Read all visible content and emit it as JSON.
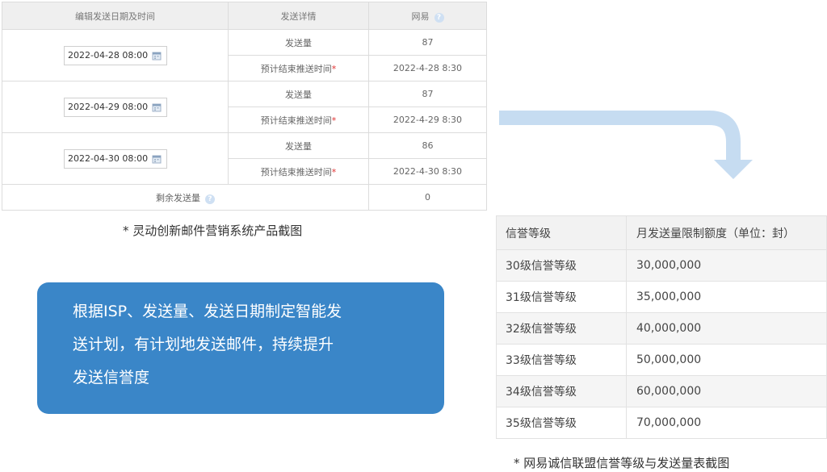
{
  "schedule": {
    "headers": {
      "date": "编辑发送日期及时间",
      "details": "发送详情",
      "isp": "网易"
    },
    "groups": [
      {
        "date": "2022-04-28 08:00",
        "volume_label": "发送量",
        "volume": "87",
        "eta_label": "预计结束推送时间",
        "eta": "2022-4-28 8:30"
      },
      {
        "date": "2022-04-29 08:00",
        "volume_label": "发送量",
        "volume": "87",
        "eta_label": "预计结束推送时间",
        "eta": "2022-4-29 8:30"
      },
      {
        "date": "2022-04-30 08:00",
        "volume_label": "发送量",
        "volume": "86",
        "eta_label": "预计结束推送时间",
        "eta": "2022-4-30 8:30"
      }
    ],
    "remaining_label": "剩余发送量",
    "remaining_value": "0",
    "required_mark": "*",
    "help_mark": "?"
  },
  "caption_left": "* 灵动创新邮件营销系统产品截图",
  "callout": {
    "line1": "根据ISP、发送量、发送日期制定智能发",
    "line2": "送计划，有计划地发送邮件，持续提升",
    "line3": "发送信誉度"
  },
  "reputation": {
    "headers": {
      "level": "信誉等级",
      "limit": "月发送量限制额度（单位：封）"
    },
    "rows": [
      {
        "level": "30级信誉等级",
        "limit": "30,000,000"
      },
      {
        "level": "31级信誉等级",
        "limit": "35,000,000"
      },
      {
        "level": "32级信誉等级",
        "limit": "40,000,000"
      },
      {
        "level": "33级信誉等级",
        "limit": "50,000,000"
      },
      {
        "level": "34级信誉等级",
        "limit": "60,000,000"
      },
      {
        "level": "35级信誉等级",
        "limit": "70,000,000"
      }
    ]
  },
  "caption_right": "* 网易诚信联盟信誉等级与发送量表截图",
  "colors": {
    "callout_bg": "#3a86c8",
    "arrow": "#c6dcf1",
    "help_icon": "#cfe0f3"
  },
  "icons": {
    "calendar": "calendar-icon",
    "help": "help-icon",
    "arrow": "arrow-down-icon"
  }
}
